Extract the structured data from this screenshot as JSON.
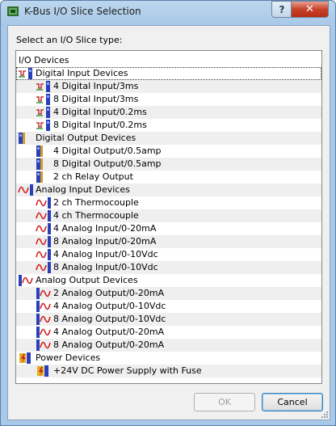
{
  "window": {
    "title": "K-Bus I/O Slice Selection",
    "help_label": "?",
    "close_label": "✕"
  },
  "prompt": "Select an I/O Slice type:",
  "tree": {
    "header": "I/O Devices",
    "rows": [
      {
        "label": "Digital Input Devices",
        "level": 0,
        "icon": "digital-input-icon",
        "selected": true
      },
      {
        "label": "4 Digital Input/3ms",
        "level": 1,
        "icon": "digital-input-icon"
      },
      {
        "label": "8 Digital Input/3ms",
        "level": 1,
        "icon": "digital-input-icon"
      },
      {
        "label": "4 Digital Input/0.2ms",
        "level": 1,
        "icon": "digital-input-icon"
      },
      {
        "label": "8 Digital Input/0.2ms",
        "level": 1,
        "icon": "digital-input-icon"
      },
      {
        "label": "Digital Output Devices",
        "level": 0,
        "icon": "digital-output-icon"
      },
      {
        "label": "4 Digital Output/0.5amp",
        "level": 1,
        "icon": "digital-output-icon"
      },
      {
        "label": "8 Digital Output/0.5amp",
        "level": 1,
        "icon": "digital-output-icon"
      },
      {
        "label": "2 ch Relay Output",
        "level": 1,
        "icon": "digital-output-icon"
      },
      {
        "label": "Analog Input Devices",
        "level": 0,
        "icon": "analog-input-icon"
      },
      {
        "label": "2 ch Thermocouple",
        "level": 1,
        "icon": "analog-input-icon"
      },
      {
        "label": "4 ch Thermocouple",
        "level": 1,
        "icon": "analog-input-icon"
      },
      {
        "label": "4 Analog Input/0-20mA",
        "level": 1,
        "icon": "analog-input-icon"
      },
      {
        "label": "8 Analog Input/0-20mA",
        "level": 1,
        "icon": "analog-input-icon"
      },
      {
        "label": "4 Analog Input/0-10Vdc",
        "level": 1,
        "icon": "analog-input-icon"
      },
      {
        "label": "8 Analog Input/0-10Vdc",
        "level": 1,
        "icon": "analog-input-icon"
      },
      {
        "label": "Analog Output Devices",
        "level": 0,
        "icon": "analog-output-icon"
      },
      {
        "label": "2 Analog Output/0-20mA",
        "level": 1,
        "icon": "analog-output-icon"
      },
      {
        "label": "4 Analog Output/0-10Vdc",
        "level": 1,
        "icon": "analog-output-icon"
      },
      {
        "label": "8 Analog Output/0-10Vdc",
        "level": 1,
        "icon": "analog-output-icon"
      },
      {
        "label": "4 Analog Output/0-20mA",
        "level": 1,
        "icon": "analog-output-icon"
      },
      {
        "label": "8 Analog Output/0-20mA",
        "level": 1,
        "icon": "analog-output-icon"
      },
      {
        "label": "Power Devices",
        "level": 0,
        "icon": "power-icon"
      },
      {
        "label": "+24V DC Power Supply with Fuse",
        "level": 1,
        "icon": "power-icon"
      }
    ]
  },
  "buttons": {
    "ok": "OK",
    "cancel": "Cancel",
    "ok_enabled": false
  },
  "colors": {
    "selection_outline": "#333333",
    "alt_row": "#efefef",
    "title_bar": "#a9c9e8",
    "close_button": "#c7422a"
  }
}
